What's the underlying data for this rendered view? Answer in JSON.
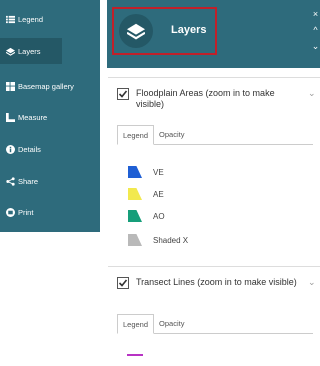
{
  "sidebar": {
    "items": [
      {
        "label": "Legend",
        "icon": "list-icon"
      },
      {
        "label": "Layers",
        "icon": "layers-icon"
      },
      {
        "label": "Basemap gallery",
        "icon": "grid-icon"
      },
      {
        "label": "Measure",
        "icon": "ruler-icon"
      },
      {
        "label": "Details",
        "icon": "info-icon"
      },
      {
        "label": "Share",
        "icon": "share-icon"
      },
      {
        "label": "Print",
        "icon": "print-icon"
      }
    ]
  },
  "header": {
    "title": "Layers",
    "close": "×",
    "up": "^",
    "down": "⌄"
  },
  "layers": [
    {
      "title": "Floodplain Areas (zoom in to make visible)",
      "checked": true,
      "tabs": [
        "Legend",
        "Opacity"
      ],
      "legend": [
        {
          "label": "VE",
          "color": "#1f5fd4"
        },
        {
          "label": "AE",
          "color": "#f2e94e"
        },
        {
          "label": "AO",
          "color": "#169e7a"
        },
        {
          "label": "Shaded X",
          "color": "#b9b9b9"
        }
      ]
    },
    {
      "title": "Transect Lines (zoom in to make visible)",
      "checked": true,
      "tabs": [
        "Legend",
        "Opacity"
      ],
      "legend": [
        {
          "label": "",
          "color": "#b833c4"
        }
      ]
    }
  ],
  "colors": {
    "accent": "#2e6b7c",
    "highlight_border": "#c0202a"
  }
}
